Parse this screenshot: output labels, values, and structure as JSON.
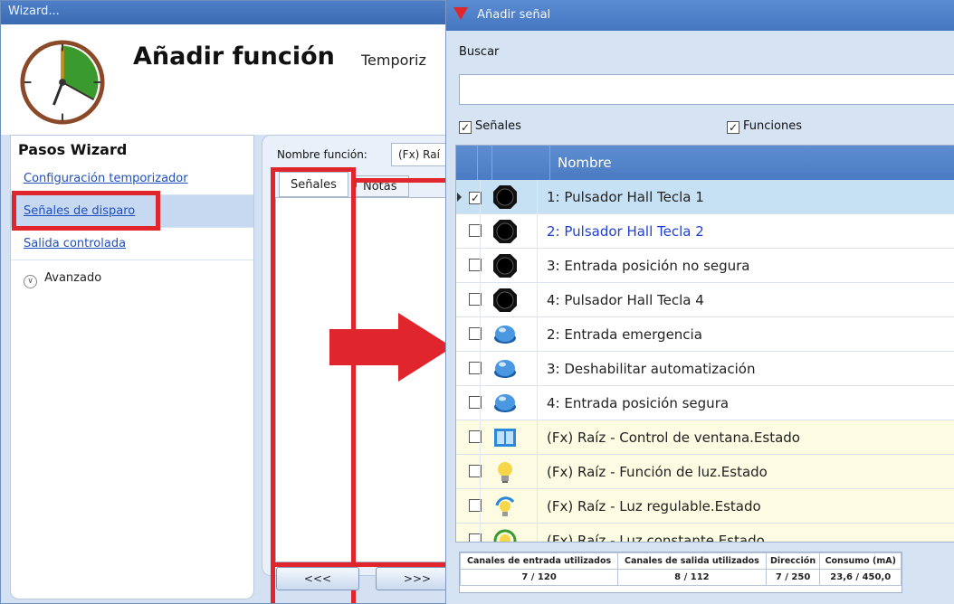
{
  "wizard": {
    "title": "Wizard...",
    "heading": "Añadir función",
    "subheading": "Temporiz",
    "steps_title": "Pasos Wizard",
    "steps": [
      {
        "label": "Configuración temporizador"
      },
      {
        "label": "Señales de disparo"
      },
      {
        "label": "Salida controlada"
      }
    ],
    "advanced_label": "Avanzado",
    "function_name_label": "Nombre función:",
    "function_name_value": "(Fx) Raí",
    "tabs": [
      "Señales",
      "Notas"
    ],
    "back_button": "<<<",
    "next_button": ">>>"
  },
  "signal_dialog": {
    "title": "Añadir señal",
    "search_label": "Buscar",
    "search_value": "",
    "filter_signals": {
      "label": "Señales",
      "checked": true
    },
    "filter_functions": {
      "label": "Funciones",
      "checked": true
    },
    "column_name": "Nombre",
    "rows": [
      {
        "checked": true,
        "icon": "hall-button-icon",
        "name": "1: Pulsador Hall Tecla 1"
      },
      {
        "checked": false,
        "icon": "hall-button-icon",
        "name": "2: Pulsador Hall Tecla 2"
      },
      {
        "checked": false,
        "icon": "hall-button-icon",
        "name": "3: Entrada posición no segura"
      },
      {
        "checked": false,
        "icon": "hall-button-icon",
        "name": "4: Pulsador Hall Tecla 4"
      },
      {
        "checked": false,
        "icon": "blue-pushbutton-icon",
        "name": "2: Entrada emergencia"
      },
      {
        "checked": false,
        "icon": "blue-pushbutton-icon",
        "name": "3: Deshabilitar automatización"
      },
      {
        "checked": false,
        "icon": "blue-pushbutton-icon",
        "name": "4: Entrada posición segura"
      },
      {
        "checked": false,
        "icon": "window-icon",
        "name": "(Fx) Raíz - Control de ventana.Estado"
      },
      {
        "checked": false,
        "icon": "light-bulb-icon",
        "name": "(Fx) Raíz - Función de luz.Estado"
      },
      {
        "checked": false,
        "icon": "dimmable-light-icon",
        "name": "(Fx) Raíz - Luz regulable.Estado"
      },
      {
        "checked": false,
        "icon": "constant-light-icon",
        "name": "(Fx) Raíz - Luz constante.Estado"
      }
    ],
    "stats": {
      "headers": [
        "Canales de entrada utilizados",
        "Canales de salida utilizados",
        "Dirección",
        "Consumo (mA)"
      ],
      "values": [
        "7 / 120",
        "8 / 112",
        "7 / 250",
        "23,6 / 450,0"
      ]
    }
  },
  "colors": {
    "accent_red": "#e0262c",
    "title_blue": "#4576c0",
    "link_blue": "#1f4fbf",
    "selected_row": "#c7e1f4",
    "function_row": "#fdfbe2"
  }
}
